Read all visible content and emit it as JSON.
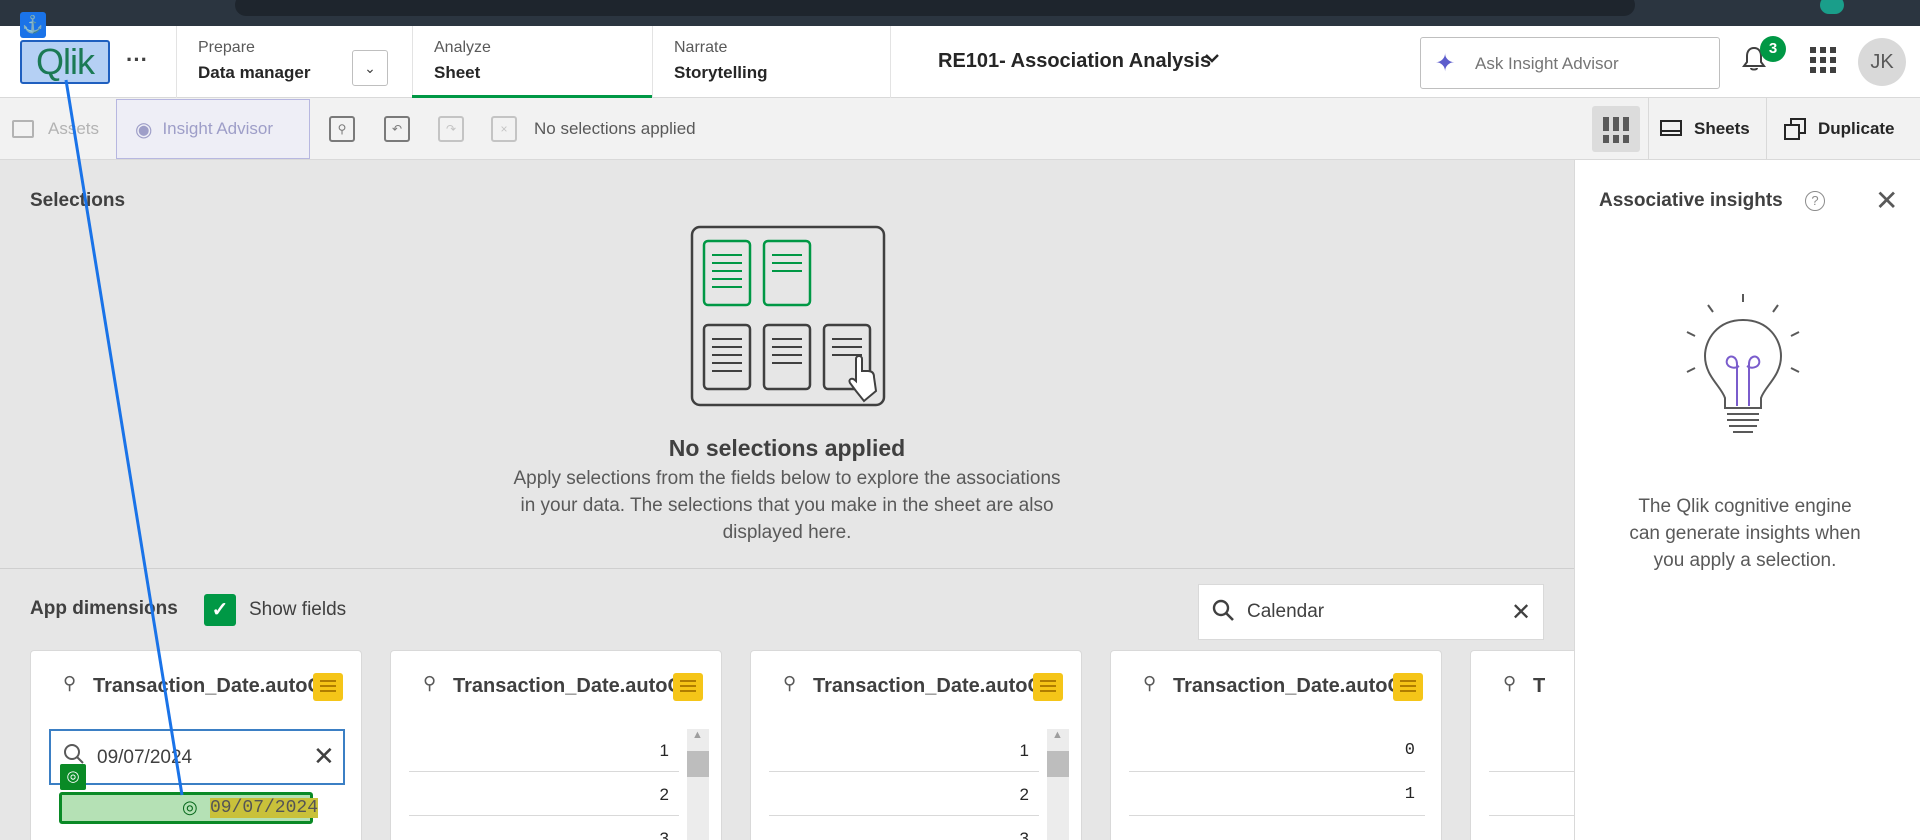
{
  "topnav": {
    "logo": "Qlik",
    "more_label": "···",
    "tabs": [
      {
        "small": "Prepare",
        "big": "Data manager"
      },
      {
        "small": "Analyze",
        "big": "Sheet"
      },
      {
        "small": "Narrate",
        "big": "Storytelling"
      }
    ],
    "app_title": "RE101- Association Analysis",
    "ask_placeholder": "Ask Insight Advisor",
    "notification_count": "3",
    "avatar_initials": "JK"
  },
  "toolbar": {
    "assets_label": "Assets",
    "insight_label": "Insight Advisor",
    "no_selections": "No selections applied",
    "sheets_label": "Sheets",
    "duplicate_label": "Duplicate"
  },
  "main": {
    "selections_title": "Selections",
    "empty_title": "No selections applied",
    "empty_body": "Apply selections from the fields below to explore the associations in your data. The selections that you make in the sheet are also displayed here.",
    "dims_title": "App dimensions",
    "show_fields_label": "Show fields",
    "search_value": "Calendar",
    "cards": [
      {
        "title": "Transaction_Date.autoCalendar.Date",
        "search_value": "09/07/2024",
        "result": "09/07/2024"
      },
      {
        "title": "Transaction_Date.autoCalendar.Day",
        "rows": [
          "1",
          "2",
          "3"
        ]
      },
      {
        "title": "Transaction_Date.autoCalendar.Month",
        "rows": [
          "1",
          "2",
          "3"
        ]
      },
      {
        "title": "Transaction_Date.autoCalendar.InYTD",
        "rows": [
          "0",
          "1"
        ]
      },
      {
        "title": "T"
      }
    ]
  },
  "right_panel": {
    "title": "Associative insights",
    "help": "?",
    "close": "✕",
    "body": "The Qlik cognitive engine can generate insights when you apply a selection."
  },
  "colors": {
    "accent_green": "#009845",
    "overlay_blue": "#1a73e8",
    "insight_purple": "#5c5ccc"
  }
}
